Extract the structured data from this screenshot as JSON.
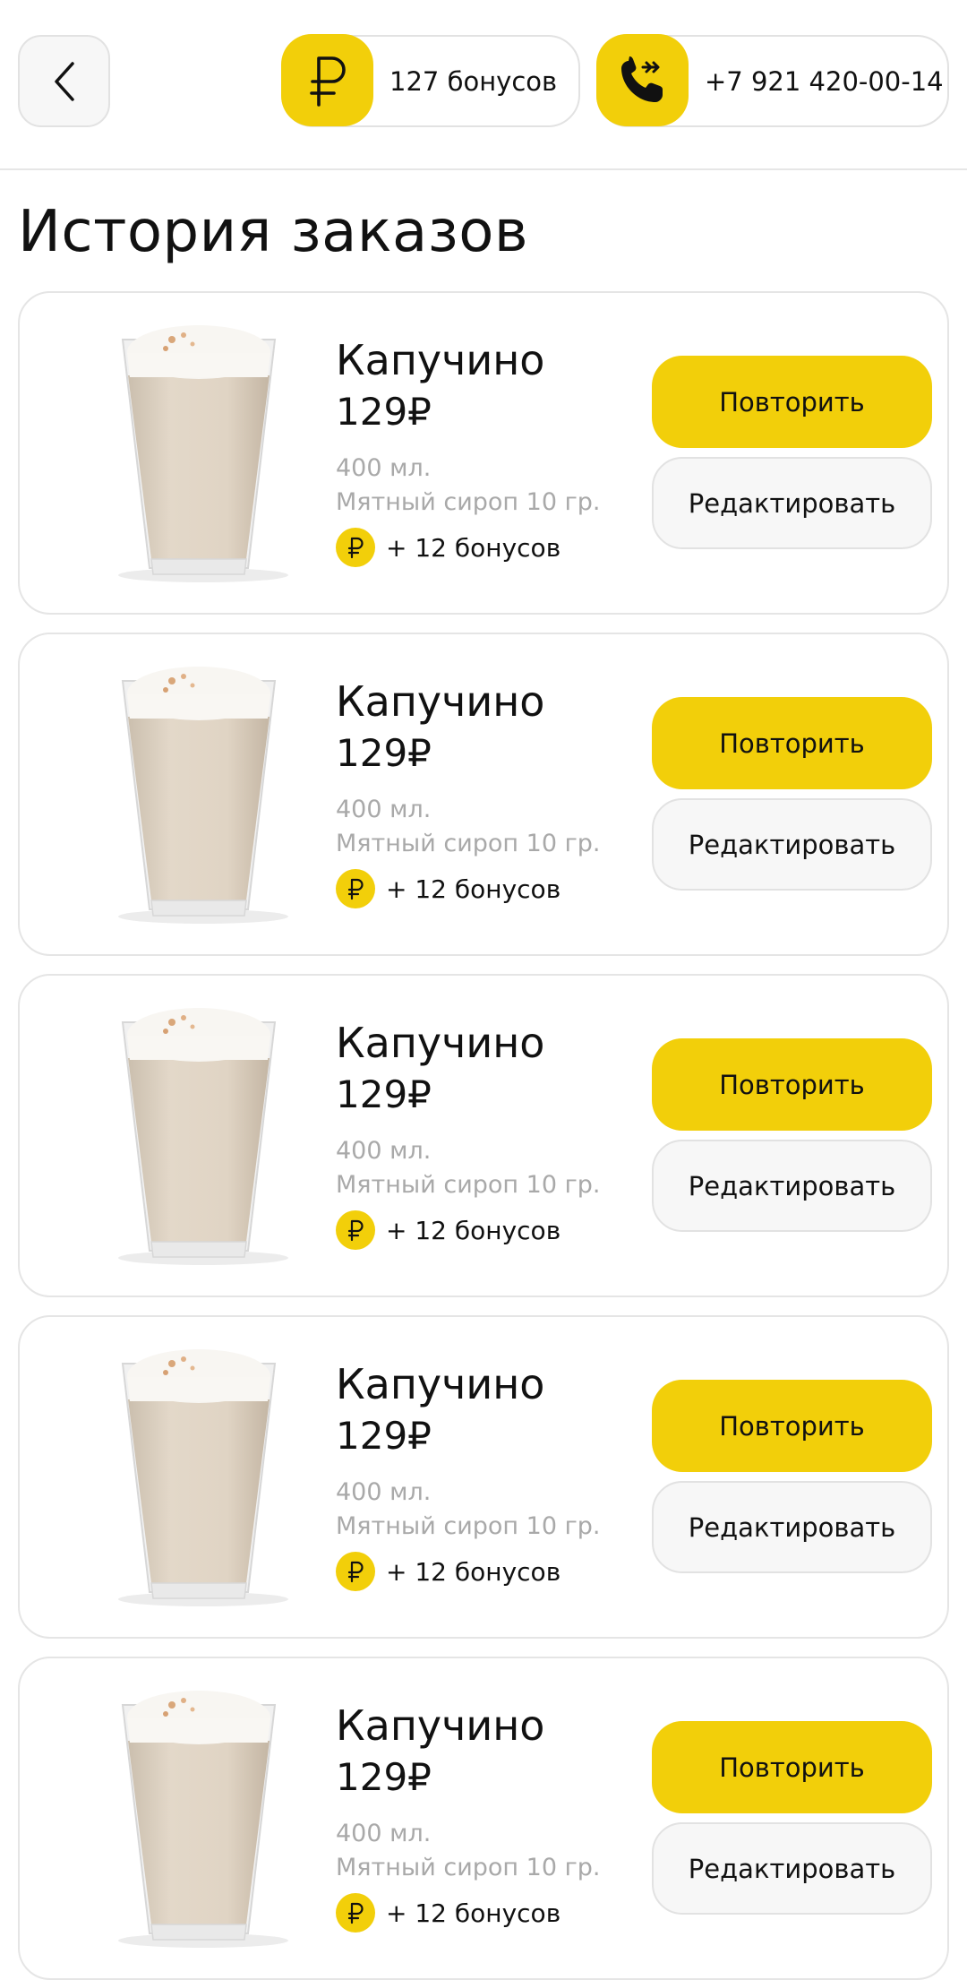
{
  "header": {
    "bonus_text": "127 бонусов",
    "phone_text": "+7 921 420-00-14"
  },
  "page_title": "История заказов",
  "colors": {
    "accent": "#f2cf0a",
    "border": "#e5e5e5",
    "muted_text": "#a9a9a9"
  },
  "icons": [
    "chevron-left-icon",
    "ruble-icon",
    "phone-forward-icon"
  ],
  "orders": [
    {
      "name": "Капучино",
      "price": "129₽",
      "size": "400 мл.",
      "syrup": "Мятный сироп 10 гр.",
      "bonus": "+ 12 бонусов",
      "repeat_label": "Повторить",
      "edit_label": "Редактировать"
    },
    {
      "name": "Капучино",
      "price": "129₽",
      "size": "400 мл.",
      "syrup": "Мятный сироп 10 гр.",
      "bonus": "+ 12 бонусов",
      "repeat_label": "Повторить",
      "edit_label": "Редактировать"
    },
    {
      "name": "Капучино",
      "price": "129₽",
      "size": "400 мл.",
      "syrup": "Мятный сироп 10 гр.",
      "bonus": "+ 12 бонусов",
      "repeat_label": "Повторить",
      "edit_label": "Редактировать"
    },
    {
      "name": "Капучино",
      "price": "129₽",
      "size": "400 мл.",
      "syrup": "Мятный сироп 10 гр.",
      "bonus": "+ 12 бонусов",
      "repeat_label": "Повторить",
      "edit_label": "Редактировать"
    },
    {
      "name": "Капучино",
      "price": "129₽",
      "size": "400 мл.",
      "syrup": "Мятный сироп 10 гр.",
      "bonus": "+ 12 бонусов",
      "repeat_label": "Повторить",
      "edit_label": "Редактировать"
    }
  ]
}
